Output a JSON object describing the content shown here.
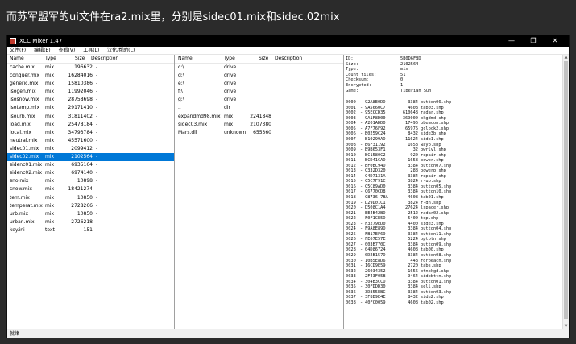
{
  "caption": "而苏军盟军的ui文件在ra2.mix里，分别是sidec01.mix和sidec.02mix",
  "window": {
    "title": "XCC Mixer 1.47",
    "controls": {
      "minimize": "—",
      "maximize": "❐",
      "close": "✕"
    }
  },
  "menu": [
    "文件(F)",
    "编辑(E)",
    "查看(V)",
    "工具(L)",
    "汉化/帮助(L)"
  ],
  "left_pane": {
    "columns": [
      "Name",
      "Type",
      "Size",
      "Description"
    ],
    "rows": [
      {
        "name": "cache.mix",
        "type": "mix",
        "size": "196632",
        "desc": "-"
      },
      {
        "name": "conquer.mix",
        "type": "mix",
        "size": "16284016",
        "desc": "-"
      },
      {
        "name": "generic.mix",
        "type": "mix",
        "size": "15810386",
        "desc": "-"
      },
      {
        "name": "isogen.mix",
        "type": "mix",
        "size": "11992046",
        "desc": "-"
      },
      {
        "name": "isosnow.mix",
        "type": "mix",
        "size": "28758698",
        "desc": "-"
      },
      {
        "name": "isotemp.mix",
        "type": "mix",
        "size": "29171410",
        "desc": "-"
      },
      {
        "name": "isourb.mix",
        "type": "mix",
        "size": "31811402",
        "desc": "-"
      },
      {
        "name": "load.mix",
        "type": "mix",
        "size": "25478184",
        "desc": "-"
      },
      {
        "name": "local.mix",
        "type": "mix",
        "size": "34793784",
        "desc": "-"
      },
      {
        "name": "neutral.mix",
        "type": "mix",
        "size": "45571600",
        "desc": "-"
      },
      {
        "name": "sidec01.mix",
        "type": "mix",
        "size": "2099412",
        "desc": "-"
      },
      {
        "name": "sidec02.mix",
        "type": "mix",
        "size": "2102564",
        "desc": "-",
        "selected": true
      },
      {
        "name": "sidenc01.mix",
        "type": "mix",
        "size": "6935164",
        "desc": "-"
      },
      {
        "name": "sidenc02.mix",
        "type": "mix",
        "size": "6974140",
        "desc": "-"
      },
      {
        "name": "sno.mix",
        "type": "mix",
        "size": "10898",
        "desc": "-"
      },
      {
        "name": "snow.mix",
        "type": "mix",
        "size": "18421274",
        "desc": "-"
      },
      {
        "name": "tem.mix",
        "type": "mix",
        "size": "10850",
        "desc": "-"
      },
      {
        "name": "temperat.mix",
        "type": "mix",
        "size": "2728266",
        "desc": "-"
      },
      {
        "name": "urb.mix",
        "type": "mix",
        "size": "10850",
        "desc": "-"
      },
      {
        "name": "urban.mix",
        "type": "mix",
        "size": "2726218",
        "desc": "-"
      },
      {
        "name": "key.ini",
        "type": "text",
        "size": "151",
        "desc": "-"
      }
    ]
  },
  "middle_pane": {
    "columns": [
      "Name",
      "Type",
      "Size",
      "Description"
    ],
    "rows": [
      {
        "name": "c:\\",
        "type": "drive",
        "size": ""
      },
      {
        "name": "d:\\",
        "type": "drive",
        "size": ""
      },
      {
        "name": "e:\\",
        "type": "drive",
        "size": ""
      },
      {
        "name": "f:\\",
        "type": "drive",
        "size": ""
      },
      {
        "name": "g:\\",
        "type": "drive",
        "size": ""
      },
      {
        "name": "..",
        "type": "dir",
        "size": ""
      },
      {
        "name": "expandmd98.mix",
        "type": "mix",
        "size": "2241848"
      },
      {
        "name": "sidec03.mix",
        "type": "mix",
        "size": "2107380"
      },
      {
        "name": "Mars.dll",
        "type": "unknown",
        "size": "655360"
      }
    ]
  },
  "info_pane": {
    "fields": [
      {
        "k": "ID:",
        "v": "5B0D6FBD"
      },
      {
        "k": "Size:",
        "v": "2102564"
      },
      {
        "k": "Type:",
        "v": "mix"
      },
      {
        "k": "Count files:",
        "v": "51"
      },
      {
        "k": "Checksum:",
        "v": "0"
      },
      {
        "k": "Encrypted:",
        "v": "1"
      },
      {
        "k": "Game:",
        "v": "Tiberian Sun"
      }
    ],
    "files": [
      {
        "i": "0000",
        "id": "92A8E0DD",
        "size": "3384",
        "name": "button06.shp"
      },
      {
        "i": "0001",
        "id": "9A5660C7",
        "size": "4608",
        "name": "tab03.shp"
      },
      {
        "i": "0002",
        "id": "95ECCD35",
        "size": "610648",
        "name": "radar.shp"
      },
      {
        "i": "0003",
        "id": "9A1F8D00",
        "size": "369000",
        "name": "bkgdmd.shp"
      },
      {
        "i": "0004",
        "id": "A201ADD0",
        "size": "17496",
        "name": "pbeacon.shp"
      },
      {
        "i": "0005",
        "id": "A7F76F92",
        "size": "65976",
        "name": "gclock2.shp"
      },
      {
        "i": "0006",
        "id": "B0259C24",
        "size": "8432",
        "name": "side3b.shp"
      },
      {
        "i": "0007",
        "id": "B10299AD",
        "size": "11624",
        "name": "side1.shp"
      },
      {
        "i": "0008",
        "id": "B6F31192",
        "size": "1658",
        "name": "wayp.shp"
      },
      {
        "i": "0009",
        "id": "B9B653F1",
        "size": "32",
        "name": "pwrlvl.shp"
      },
      {
        "i": "0010",
        "id": "BC1580C2",
        "size": "920",
        "name": "repair.shp"
      },
      {
        "i": "0011",
        "id": "BCD41CAD",
        "size": "1658",
        "name": "power.shp"
      },
      {
        "i": "0012",
        "id": "BF0BC94D",
        "size": "3384",
        "name": "button07.shp"
      },
      {
        "i": "0013",
        "id": "C332D320",
        "size": "288",
        "name": "powerp.shp"
      },
      {
        "i": "0014",
        "id": "C4D7131A",
        "size": "3384",
        "name": "repair.shp"
      },
      {
        "i": "0015",
        "id": "C5C7F91C",
        "size": "3824",
        "name": "r-up.shp"
      },
      {
        "i": "0016",
        "id": "C5C89AD0",
        "size": "3384",
        "name": "button05.shp"
      },
      {
        "i": "0017",
        "id": "C6770CD8",
        "size": "3384",
        "name": "button10.shp"
      },
      {
        "i": "0018",
        "id": "C8736 7BA",
        "size": "4608",
        "name": "tab01.shp"
      },
      {
        "i": "0019",
        "id": "D29D01C1",
        "size": "3824",
        "name": "r-dn.shp"
      },
      {
        "i": "0020",
        "id": "D508C1A4",
        "size": "27624",
        "name": "lspacer.shp"
      },
      {
        "i": "0021",
        "id": "EE4B42BD",
        "size": "2512",
        "name": "radar02.shp"
      },
      {
        "i": "0022",
        "id": "F0F1CE5D",
        "size": "5400",
        "name": "top.shp"
      },
      {
        "i": "0023",
        "id": "F3279ED0",
        "size": "4400",
        "name": "side3.shp"
      },
      {
        "i": "0024",
        "id": "F9A8E89D",
        "size": "3384",
        "name": "button04.shp"
      },
      {
        "i": "0025",
        "id": "FB17EF69",
        "size": "3384",
        "name": "button11.shp"
      },
      {
        "i": "0026",
        "id": "FE67E57E",
        "size": "5224",
        "name": "optbtn.shp"
      },
      {
        "i": "0027",
        "id": "003B770C",
        "size": "3384",
        "name": "button09.shp"
      },
      {
        "i": "0028",
        "id": "04D86724",
        "size": "4608",
        "name": "tab00.shp"
      },
      {
        "i": "0029",
        "id": "0D2B157D",
        "size": "3384",
        "name": "button08.shp"
      },
      {
        "i": "0030",
        "id": "10B5E8D6",
        "size": "448",
        "name": "rdrbeacn.shp"
      },
      {
        "i": "0031",
        "id": "16CD9E59",
        "size": "2720",
        "name": "tabs.shp"
      },
      {
        "i": "0032",
        "id": "26034352",
        "size": "1656",
        "name": "btnbkgd.shp"
      },
      {
        "i": "0033",
        "id": "2F43F05B",
        "size": "9464",
        "name": "sidebttn.shp"
      },
      {
        "i": "0034",
        "id": "304B3CCD",
        "size": "3384",
        "name": "button01.shp"
      },
      {
        "i": "0035",
        "id": "30FDDD30",
        "size": "3384",
        "name": "sell.shp"
      },
      {
        "i": "0036",
        "id": "3D855EBC",
        "size": "3384",
        "name": "button03.shp"
      },
      {
        "i": "0037",
        "id": "3F8D9E4E",
        "size": "8432",
        "name": "side2.shp"
      },
      {
        "i": "0038",
        "id": "40FC0059",
        "size": "4608",
        "name": "tab02.shp"
      }
    ]
  },
  "status": "就绪",
  "colors": {
    "selection": "#0078d7",
    "titlebar": "#000000"
  }
}
